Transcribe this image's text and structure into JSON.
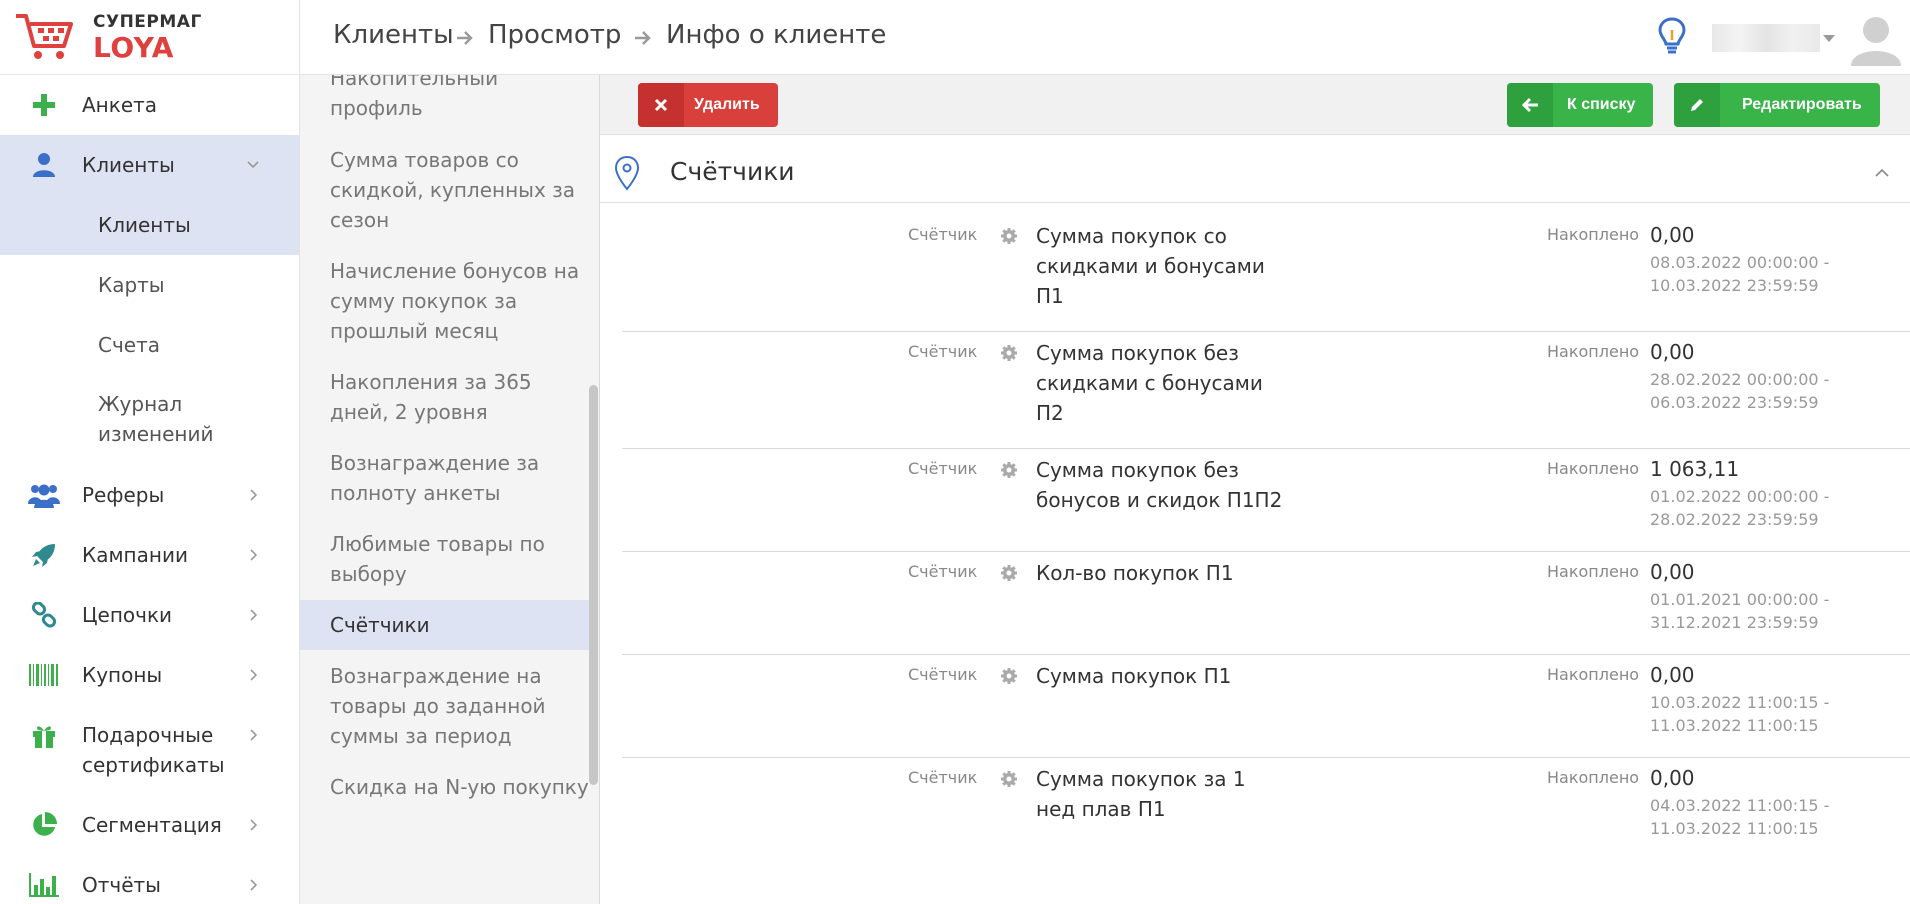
{
  "brand": {
    "line1": "СУПЕРМАГ",
    "line2": "LOYA"
  },
  "breadcrumb": [
    "Клиенты",
    "Просмотр",
    "Инфо о клиенте"
  ],
  "sidebar": {
    "items": [
      {
        "label": "Анкета",
        "icon": "plus-icon"
      },
      {
        "label": "Клиенты",
        "icon": "user-icon"
      },
      {
        "label": "Клиенты"
      },
      {
        "label": "Карты"
      },
      {
        "label": "Счета"
      },
      {
        "label": "Журнал изменений"
      },
      {
        "label": "Реферы",
        "icon": "users-group-icon"
      },
      {
        "label": "Кампании",
        "icon": "rocket-icon"
      },
      {
        "label": "Цепочки",
        "icon": "link-icon"
      },
      {
        "label": "Купоны",
        "icon": "barcode-icon"
      },
      {
        "label": "Подарочные сертификаты",
        "icon": "gift-icon"
      },
      {
        "label": "Сегментация",
        "icon": "pie-chart-icon"
      },
      {
        "label": "Отчёты",
        "icon": "bar-chart-icon"
      }
    ]
  },
  "midlist": {
    "items": [
      "Накопительный профиль",
      "Сумма товаров со скидкой, купленных за сезон",
      "Начисление бонусов на сумму покупок за прошлый месяц",
      "Накопления за 365 дней, 2 уровня",
      "Вознаграждение за полноту анкеты",
      "Любимые товары по выбору",
      "Счётчики",
      "Вознаграждение на товары до заданной суммы за период",
      "Скидка на N-ую покупку"
    ]
  },
  "toolbar": {
    "delete_label": "Удалить",
    "back_label": "К списку",
    "edit_label": "Редактировать"
  },
  "panel": {
    "title": "Счётчики"
  },
  "counters": [
    {
      "label": "Счётчик",
      "name": "Сумма покупок со скидками и бонусами П1",
      "acc_label": "Накоплено",
      "value": "0,00",
      "period_from": "08.03.2022 00:00:00 -",
      "period_to": "10.03.2022 23:59:59"
    },
    {
      "label": "Счётчик",
      "name": "Сумма покупок без скидками с бонусами П2",
      "acc_label": "Накоплено",
      "value": "0,00",
      "period_from": "28.02.2022 00:00:00 -",
      "period_to": "06.03.2022 23:59:59"
    },
    {
      "label": "Счётчик",
      "name": "Сумма покупок без бонусов и скидок П1П2",
      "acc_label": "Накоплено",
      "value": "1 063,11",
      "period_from": "01.02.2022 00:00:00 -",
      "period_to": "28.02.2022 23:59:59"
    },
    {
      "label": "Счётчик",
      "name": "Кол-во покупок П1",
      "acc_label": "Накоплено",
      "value": "0,00",
      "period_from": "01.01.2021 00:00:00 -",
      "period_to": "31.12.2021 23:59:59"
    },
    {
      "label": "Счётчик",
      "name": "Сумма покупок П1",
      "acc_label": "Накоплено",
      "value": "0,00",
      "period_from": "10.03.2022 11:00:15 -",
      "period_to": "11.03.2022 11:00:15"
    },
    {
      "label": "Счётчик",
      "name": "Сумма покупок за 1 нед плав П1",
      "acc_label": "Накоплено",
      "value": "0,00",
      "period_from": "04.03.2022 11:00:15 -",
      "period_to": "11.03.2022 11:00:15"
    }
  ],
  "colors": {
    "accent_red": "#e0413e",
    "button_green": "#38b449",
    "active_bg": "#dde3f3",
    "icon_green": "#3bb04b",
    "icon_blue": "#3b6fc8"
  }
}
